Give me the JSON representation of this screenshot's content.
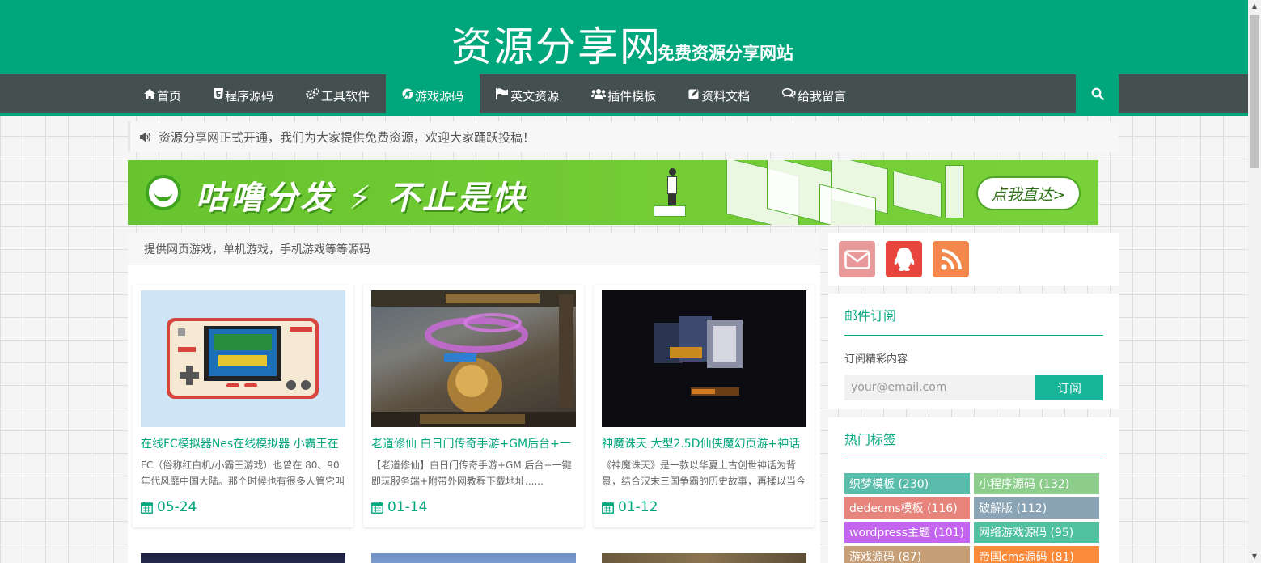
{
  "header": {
    "title": "资源分享网",
    "subtitle": "免费资源分享网站"
  },
  "nav": {
    "items": [
      {
        "label": "首页",
        "icon": "home-icon"
      },
      {
        "label": "程序源码",
        "icon": "html5-icon"
      },
      {
        "label": "工具软件",
        "icon": "cogs-icon"
      },
      {
        "label": "游戏源码",
        "icon": "chrome-icon",
        "active": true
      },
      {
        "label": "英文资源",
        "icon": "flag-icon"
      },
      {
        "label": "插件模板",
        "icon": "users-icon"
      },
      {
        "label": "资料文档",
        "icon": "edit-icon"
      },
      {
        "label": "给我留言",
        "icon": "comments-icon"
      }
    ],
    "search_icon": "search-icon"
  },
  "notice": {
    "text": "资源分享网正式开通，我们为大家提供免费资源，欢迎大家踊跃投稿！"
  },
  "banner": {
    "headline": "咕噜分发 ⚡ 不止是快",
    "button": "点我直达>"
  },
  "category": {
    "description": "提供网页游戏，单机游戏，手机游戏等等源码"
  },
  "posts": [
    {
      "title": "在线FC模拟器Nes在线模拟器 小霸王在",
      "excerpt": "FC（俗称红白机/小霸王游戏）也曾在 80、90 年代风靡中国大陆。那个时候也有很多人管它叫",
      "date": "05-24"
    },
    {
      "title": "老道修仙 白日门传奇手游+GM后台+一",
      "excerpt": "【老道修仙】白日门传奇手游+GM 后台+一键即玩服务端+附带外网教程下载地址......",
      "date": "01-14"
    },
    {
      "title": "神魔诛天 大型2.5D仙侠魔幻页游+神话",
      "excerpt": "《神魔诛天》是一款以华夏上古创世神话为背景，结合汉末三国争霸的历史故事，再揉以当今",
      "date": "01-12"
    }
  ],
  "sidebar": {
    "social": [
      {
        "icon": "mail-icon",
        "color": "#e89a9a"
      },
      {
        "icon": "qq-icon",
        "color": "#e8453c"
      },
      {
        "icon": "rss-icon",
        "color": "#f4874b"
      }
    ],
    "subscribe": {
      "title": "邮件订阅",
      "subtitle": "订阅精彩内容",
      "placeholder": "your@email.com",
      "button": "订阅"
    },
    "tags": {
      "title": "热门标签",
      "items": [
        {
          "label": "织梦模板 (230)",
          "color": "#5abcab"
        },
        {
          "label": "小程序源码 (132)",
          "color": "#8ccd8c"
        },
        {
          "label": "dedecms模板 (116)",
          "color": "#e7847c"
        },
        {
          "label": "破解版 (112)",
          "color": "#8aa3b5"
        },
        {
          "label": "wordpress主题 (101)",
          "color": "#c465f0"
        },
        {
          "label": "网络游戏源码 (95)",
          "color": "#4fc19e"
        },
        {
          "label": "游戏源码 (87)",
          "color": "#c79f77"
        },
        {
          "label": "帝国cms源码 (81)",
          "color": "#fb8a3a"
        }
      ]
    }
  }
}
